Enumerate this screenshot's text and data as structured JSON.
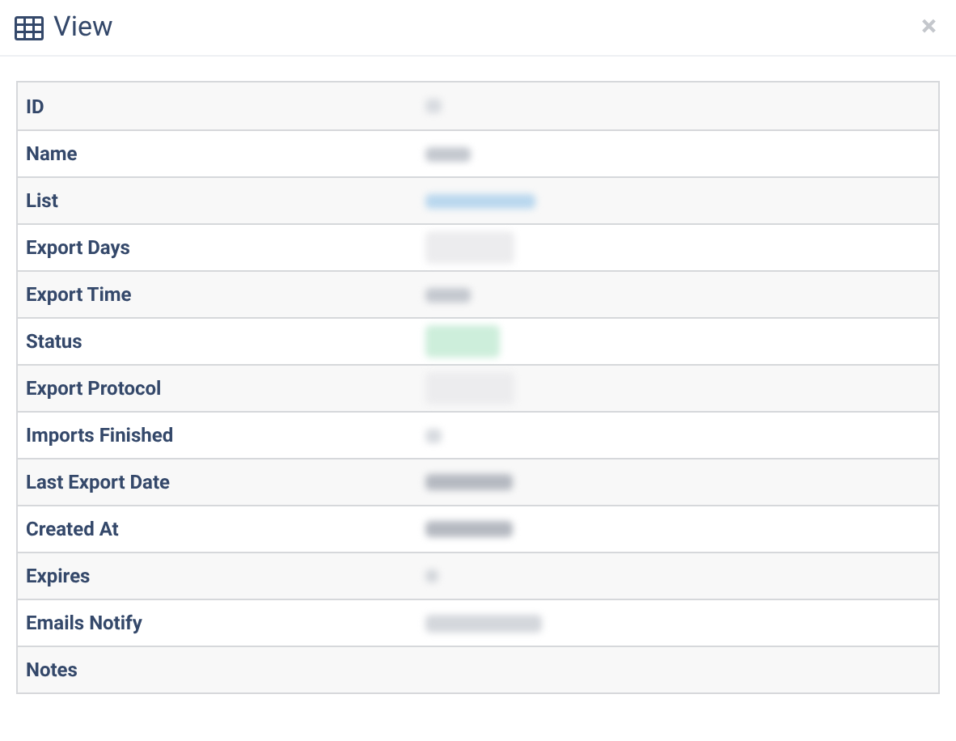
{
  "dialog": {
    "title": "View",
    "close": "×"
  },
  "rows": [
    {
      "label": "ID",
      "kind": "short"
    },
    {
      "label": "Name",
      "kind": "text"
    },
    {
      "label": "List",
      "kind": "link"
    },
    {
      "label": "Export Days",
      "kind": "tag"
    },
    {
      "label": "Export Time",
      "kind": "text"
    },
    {
      "label": "Status",
      "kind": "success"
    },
    {
      "label": "Export Protocol",
      "kind": "tag"
    },
    {
      "label": "Imports Finished",
      "kind": "short"
    },
    {
      "label": "Last Export Date",
      "kind": "date"
    },
    {
      "label": "Created At",
      "kind": "date"
    },
    {
      "label": "Expires",
      "kind": "faint"
    },
    {
      "label": "Emails Notify",
      "kind": "email"
    },
    {
      "label": "Notes",
      "kind": "none"
    }
  ]
}
